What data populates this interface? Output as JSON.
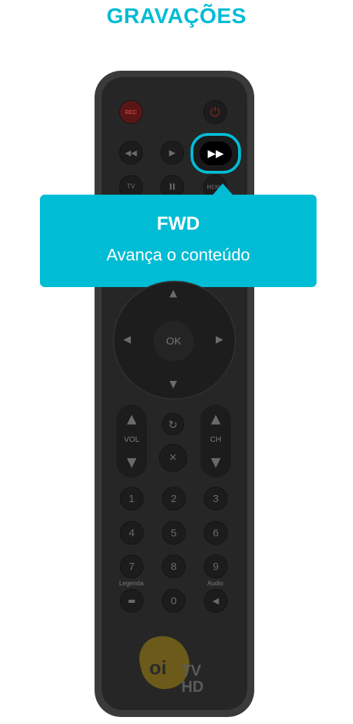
{
  "header": {
    "title": "GRAVAÇÕES"
  },
  "tooltip": {
    "title": "FWD",
    "description": "Avança o conteúdo"
  },
  "remote": {
    "top_row": {
      "rec_label": "REC",
      "power_symbol": "⏻"
    },
    "transport": {
      "rewind": "◀◀",
      "play": "▶",
      "forward": "▶▶"
    },
    "second_row": {
      "tv_label": "TV",
      "pause": "II",
      "menu_label": "MENU"
    },
    "dpad": {
      "ok_label": "OK",
      "up": "▲",
      "down": "▼",
      "left": "◀",
      "right": "▶"
    },
    "volume_label": "VOL",
    "channel_label": "CH",
    "back_symbol": "↻",
    "mute_symbol": "🔇",
    "numbers": [
      "1",
      "2",
      "3",
      "4",
      "5",
      "6",
      "7",
      "8",
      "9",
      "0"
    ],
    "legend_label": "Legenda",
    "audio_label": "Audio",
    "brand": {
      "oi": "oi",
      "tv": "TV",
      "hd": "HD"
    }
  },
  "colors": {
    "accent": "#00bcd4",
    "remote_body": "#262626",
    "highlight_text": "#ffffff"
  },
  "icons": [
    "rec-icon",
    "power-icon",
    "rewind-icon",
    "play-icon",
    "fast-forward-icon",
    "pause-icon",
    "back-icon",
    "mute-icon",
    "subtitle-icon",
    "audio-icon"
  ]
}
